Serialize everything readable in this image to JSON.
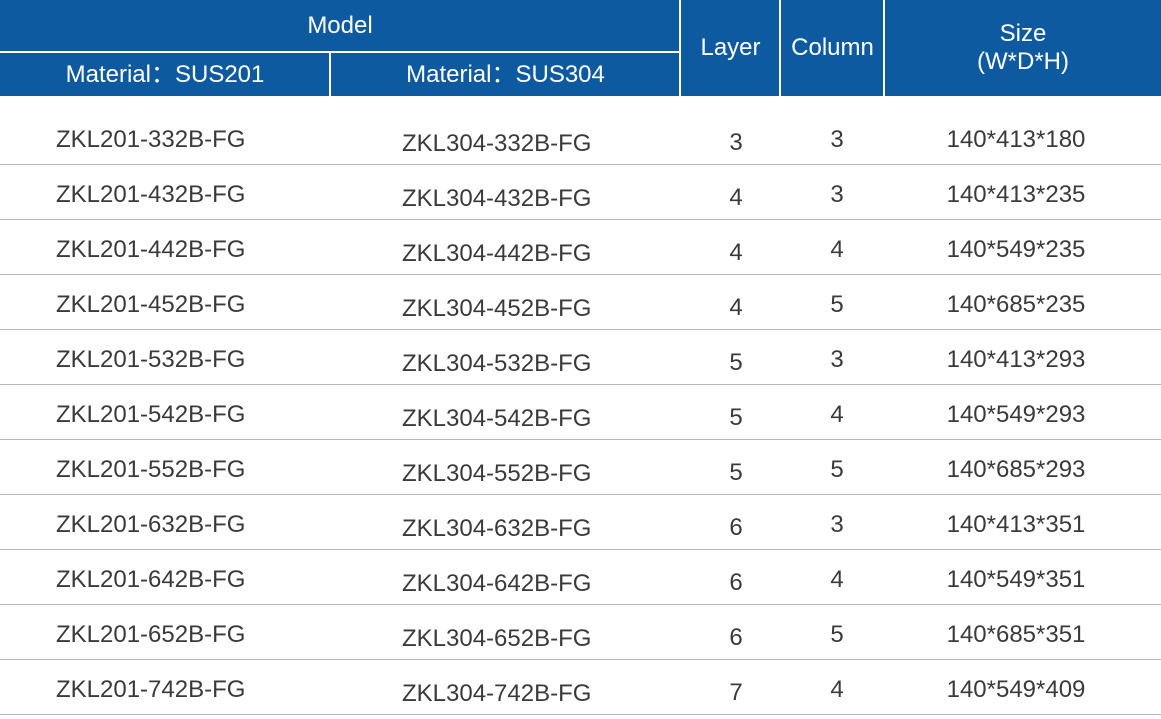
{
  "header": {
    "model": "Model",
    "material_201": "Material：SUS201",
    "material_304": "Material：SUS304",
    "layer": "Layer",
    "column": "Column",
    "size_line1": "Size",
    "size_line2": "(W*D*H)"
  },
  "colors": {
    "header_bg": "#0d5aa0",
    "header_text": "#ffffff",
    "body_text": "#3a3a3a",
    "row_divider": "#b9b9b9"
  },
  "rows": [
    {
      "sus201": "ZKL201-332B-FG",
      "sus304": "ZKL304-332B-FG",
      "layer": "3",
      "column": "3",
      "size": "140*413*180"
    },
    {
      "sus201": "ZKL201-432B-FG",
      "sus304": "ZKL304-432B-FG",
      "layer": "4",
      "column": "3",
      "size": "140*413*235"
    },
    {
      "sus201": "ZKL201-442B-FG",
      "sus304": "ZKL304-442B-FG",
      "layer": "4",
      "column": "4",
      "size": "140*549*235"
    },
    {
      "sus201": "ZKL201-452B-FG",
      "sus304": "ZKL304-452B-FG",
      "layer": "4",
      "column": "5",
      "size": "140*685*235"
    },
    {
      "sus201": "ZKL201-532B-FG",
      "sus304": "ZKL304-532B-FG",
      "layer": "5",
      "column": "3",
      "size": "140*413*293"
    },
    {
      "sus201": "ZKL201-542B-FG",
      "sus304": "ZKL304-542B-FG",
      "layer": "5",
      "column": "4",
      "size": "140*549*293"
    },
    {
      "sus201": "ZKL201-552B-FG",
      "sus304": "ZKL304-552B-FG",
      "layer": "5",
      "column": "5",
      "size": "140*685*293"
    },
    {
      "sus201": "ZKL201-632B-FG",
      "sus304": "ZKL304-632B-FG",
      "layer": "6",
      "column": "3",
      "size": "140*413*351"
    },
    {
      "sus201": "ZKL201-642B-FG",
      "sus304": "ZKL304-642B-FG",
      "layer": "6",
      "column": "4",
      "size": "140*549*351"
    },
    {
      "sus201": "ZKL201-652B-FG",
      "sus304": "ZKL304-652B-FG",
      "layer": "6",
      "column": "5",
      "size": "140*685*351"
    },
    {
      "sus201": "ZKL201-742B-FG",
      "sus304": "ZKL304-742B-FG",
      "layer": "7",
      "column": "4",
      "size": "140*549*409"
    }
  ]
}
